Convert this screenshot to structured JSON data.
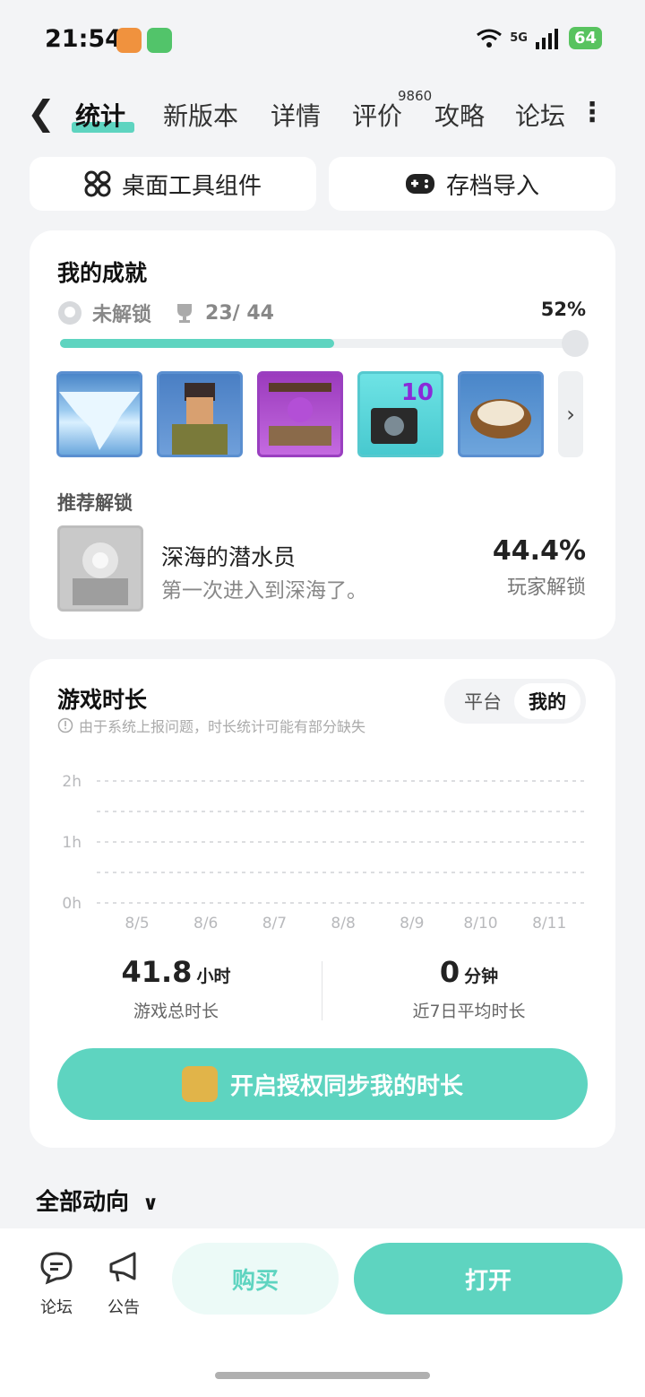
{
  "status_bar": {
    "time": "21:54",
    "network": "5G",
    "battery": "64"
  },
  "nav": {
    "tabs": [
      "统计",
      "新版本",
      "详情",
      "评价",
      "攻略",
      "论坛"
    ],
    "review_count": "9860"
  },
  "top_buttons": {
    "widget": "桌面工具组件",
    "save_import": "存档导入"
  },
  "achievements": {
    "title": "我的成就",
    "locked_label": "未解锁",
    "count": "23/ 44",
    "percent": "52%",
    "progress_value": 0.52,
    "recommend_label": "推荐解锁",
    "tile_badge": "10",
    "recommended": {
      "name": "深海的潜水员",
      "desc": "第一次进入到深海了。",
      "percent": "44.4%",
      "percent_label": "玩家解锁"
    }
  },
  "playtime": {
    "title": "游戏时长",
    "hint": "由于系统上报问题，时长统计可能有部分缺失",
    "toggle": {
      "platform": "平台",
      "mine": "我的"
    },
    "total_value": "41.8",
    "total_unit": "小时",
    "total_label": "游戏总时长",
    "avg_value": "0",
    "avg_unit": "分钟",
    "avg_label": "近7日平均时长",
    "sync_button": "开启授权同步我的时长"
  },
  "chart_data": {
    "type": "bar",
    "categories": [
      "8/5",
      "8/6",
      "8/7",
      "8/8",
      "8/9",
      "8/10",
      "8/11"
    ],
    "values": [
      0,
      0,
      0,
      0,
      0,
      0,
      0
    ],
    "y_ticks": [
      "0h",
      "1h",
      "2h"
    ],
    "ylim": [
      0,
      2
    ],
    "grid": true
  },
  "feed": {
    "title": "全部动向"
  },
  "bottom_bar": {
    "forum": "论坛",
    "notice": "公告",
    "buy": "购买",
    "open": "打开"
  },
  "colors": {
    "accent": "#5ed4c0",
    "background": "#f3f4f6"
  }
}
